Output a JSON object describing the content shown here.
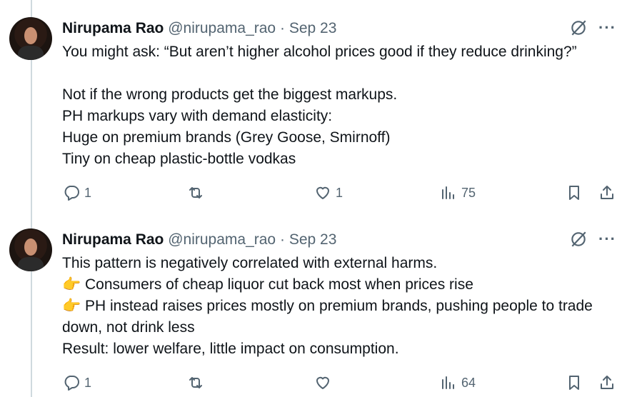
{
  "tweets": [
    {
      "name": "Nirupama Rao",
      "handle": "@nirupama_rao",
      "sep": "·",
      "date": "Sep 23",
      "text": "You might ask: “But aren’t higher alcohol prices good if they reduce drinking?”\n\nNot if the wrong products get the biggest markups.\nPH markups vary with demand elasticity:\nHuge on premium brands (Grey Goose, Smirnoff)\nTiny on cheap plastic-bottle vodkas",
      "replies": "1",
      "retweets": "",
      "likes": "1",
      "views": "75"
    },
    {
      "name": "Nirupama Rao",
      "handle": "@nirupama_rao",
      "sep": "·",
      "date": "Sep 23",
      "text": "This pattern is negatively correlated with external harms.\n👉 Consumers of cheap liquor cut back most when prices rise\n👉 PH instead raises prices mostly on premium brands, pushing people to trade down, not drink less\nResult: lower welfare, little impact on consumption.",
      "replies": "1",
      "retweets": "",
      "likes": "",
      "views": "64"
    }
  ],
  "more_label": "···",
  "colors": {
    "text": "#0f1419",
    "muted": "#536471",
    "line": "#cfd9de"
  }
}
